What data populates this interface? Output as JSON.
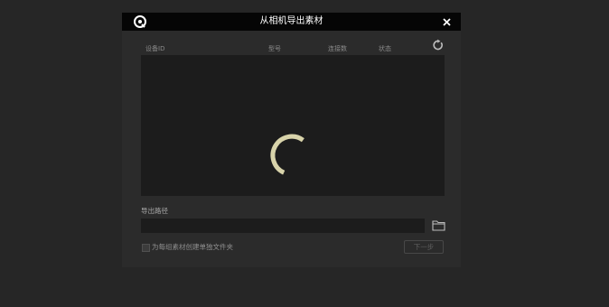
{
  "dialog": {
    "title": "从相机导出素材",
    "logo_icon": "app-logo-icon",
    "close_icon": "close-icon"
  },
  "device_list": {
    "columns": [
      "设备ID",
      "型号",
      "连接数",
      "状态"
    ],
    "refresh_icon": "refresh-icon",
    "loading": true,
    "spinner_color": "#d8d3aa",
    "rows": []
  },
  "export_path": {
    "label": "导出路径",
    "value": "",
    "browse_icon": "folder-icon"
  },
  "options": {
    "create_folder_label": "为每组素材创建单独文件夹",
    "create_folder_checked": false
  },
  "footer": {
    "next_label": "下一步",
    "next_enabled": false
  }
}
